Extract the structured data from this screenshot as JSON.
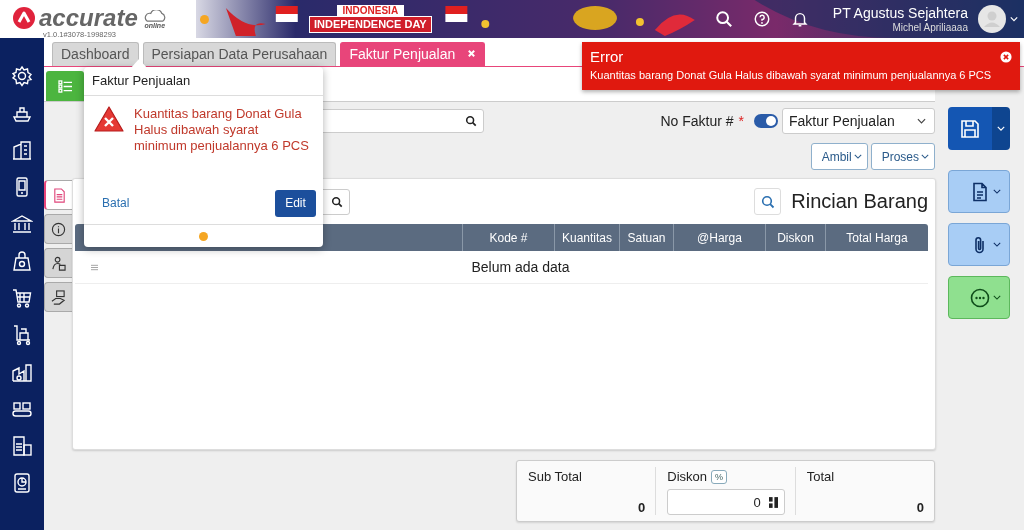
{
  "header": {
    "logo": "accurate",
    "logo_sub": "online",
    "version": "v1.0.1#3078-1998293",
    "banner_lines": [
      "INDONESIA",
      "INDEPENDENCE DAY"
    ],
    "company": "PT Agustus Sejahtera",
    "user": "Michel Apriliaaaa"
  },
  "tabs": [
    {
      "label": "Dashboard",
      "selected": false,
      "closable": false
    },
    {
      "label": "Persiapan Data Perusahaan",
      "selected": false,
      "closable": false
    },
    {
      "label": "Faktur Penjualan",
      "selected": true,
      "closable": true
    }
  ],
  "form": {
    "no_faktur_label": "No Faktur #",
    "required_mark": "*",
    "auto_number": true,
    "type_value": "Faktur Penjualan",
    "buttons": [
      "Ambil",
      "Proses"
    ]
  },
  "side_tabs": [
    {
      "selected": true
    },
    {
      "selected": false
    },
    {
      "selected": false
    },
    {
      "selected": false
    }
  ],
  "items": {
    "title": "Rincian Barang",
    "columns": [
      "Kode #",
      "Kuantitas",
      "Satuan",
      "@Harga",
      "Diskon",
      "Total Harga"
    ],
    "empty_text": "Belum ada data"
  },
  "totals": {
    "sub_total_label": "Sub Total",
    "sub_total": "0",
    "discount_label": "Diskon",
    "discount_unit": "%",
    "discount": "0",
    "total_label": "Total",
    "total": "0"
  },
  "popover": {
    "title": "Faktur Penjualan",
    "message": "Kuantitas barang Donat Gula Halus dibawah syarat minimum penjualannya 6 PCS",
    "cancel": "Batal",
    "confirm": "Edit"
  },
  "toast": {
    "title": "Error",
    "message": "Kuantitas barang Donat Gula Halus dibawah syarat minimum penjualannya 6 PCS"
  }
}
